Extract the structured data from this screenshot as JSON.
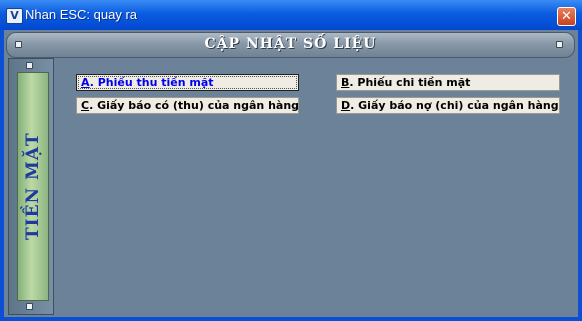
{
  "window": {
    "title": "Nhan ESC: quay ra",
    "icon_glyph": "V",
    "close_glyph": "✕"
  },
  "header": {
    "title": "CẬP NHẬT SỐ LIỆU"
  },
  "side_tab": {
    "label": "TIỀN MẶT"
  },
  "options": [
    {
      "key": "A",
      "label": ". Phiếu thu tiền mặt",
      "selected": true
    },
    {
      "key": "B",
      "label": ". Phiếu chi tiền mặt",
      "selected": false
    },
    {
      "key": "C",
      "label": ". Giấy báo có (thu) của ngân hàng",
      "selected": false
    },
    {
      "key": "D",
      "label": ". Giấy báo nợ (chi) của ngân hàng",
      "selected": false
    }
  ]
}
